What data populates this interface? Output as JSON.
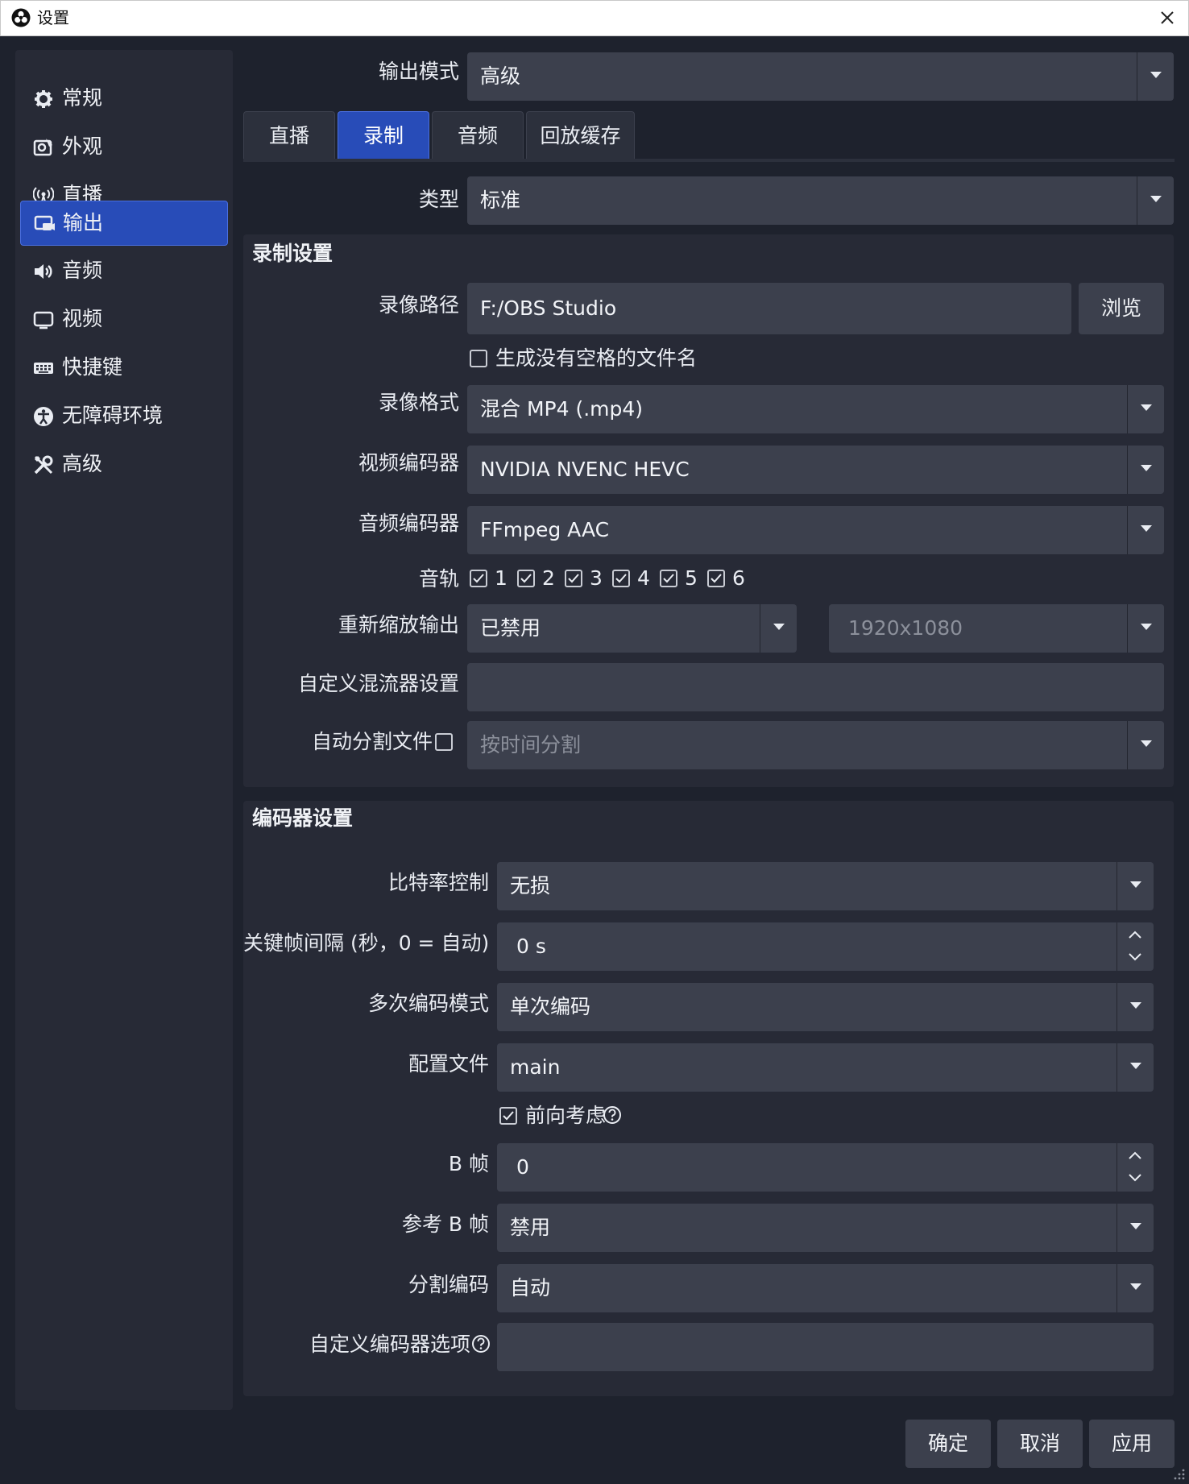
{
  "window": {
    "title": "设置"
  },
  "sidebar": {
    "items": [
      {
        "label": "常规",
        "icon": "gear-icon"
      },
      {
        "label": "外观",
        "icon": "appearance-icon"
      },
      {
        "label": "直播",
        "icon": "broadcast-icon"
      },
      {
        "label": "输出",
        "icon": "output-icon",
        "active": true
      },
      {
        "label": "音频",
        "icon": "speaker-icon"
      },
      {
        "label": "视频",
        "icon": "monitor-icon"
      },
      {
        "label": "快捷键",
        "icon": "keyboard-icon"
      },
      {
        "label": "无障碍环境",
        "icon": "accessibility-icon"
      },
      {
        "label": "高级",
        "icon": "tools-icon"
      }
    ]
  },
  "output_mode": {
    "label": "输出模式",
    "value": "高级"
  },
  "tabs": [
    {
      "label": "直播"
    },
    {
      "label": "录制",
      "active": true
    },
    {
      "label": "音频"
    },
    {
      "label": "回放缓存"
    }
  ],
  "type": {
    "label": "类型",
    "value": "标准"
  },
  "recording": {
    "title": "录制设置",
    "path": {
      "label": "录像路径",
      "value": "F:/OBS Studio",
      "browse": "浏览"
    },
    "no_space": {
      "label": "生成没有空格的文件名",
      "checked": false
    },
    "format": {
      "label": "录像格式",
      "value": "混合 MP4 (.mp4)"
    },
    "video_encoder": {
      "label": "视频编码器",
      "value": "NVIDIA NVENC HEVC"
    },
    "audio_encoder": {
      "label": "音频编码器",
      "value": "FFmpeg AAC"
    },
    "tracks": {
      "label": "音轨",
      "items": [
        "1",
        "2",
        "3",
        "4",
        "5",
        "6"
      ]
    },
    "rescale": {
      "label": "重新缩放输出",
      "value": "已禁用",
      "resolution": "1920x1080"
    },
    "muxer": {
      "label": "自定义混流器设置",
      "value": ""
    },
    "autosplit": {
      "label": "自动分割文件",
      "checked": false,
      "value": "按时间分割"
    }
  },
  "encoder": {
    "title": "编码器设置",
    "rate_control": {
      "label": "比特率控制",
      "value": "无损"
    },
    "keyframe": {
      "label": "关键帧间隔 (秒，0 = 自动)",
      "value": "0 s"
    },
    "multipass": {
      "label": "多次编码模式",
      "value": "单次编码"
    },
    "profile": {
      "label": "配置文件",
      "value": "main"
    },
    "lookahead": {
      "label": "前向考虑",
      "checked": true
    },
    "bframes": {
      "label": "B 帧",
      "value": "0"
    },
    "ref_bframes": {
      "label": "参考 B 帧",
      "value": "禁用"
    },
    "split_encode": {
      "label": "分割编码",
      "value": "自动"
    },
    "custom_opts": {
      "label": "自定义编码器选项",
      "value": ""
    }
  },
  "footer": {
    "ok": "确定",
    "cancel": "取消",
    "apply": "应用"
  }
}
